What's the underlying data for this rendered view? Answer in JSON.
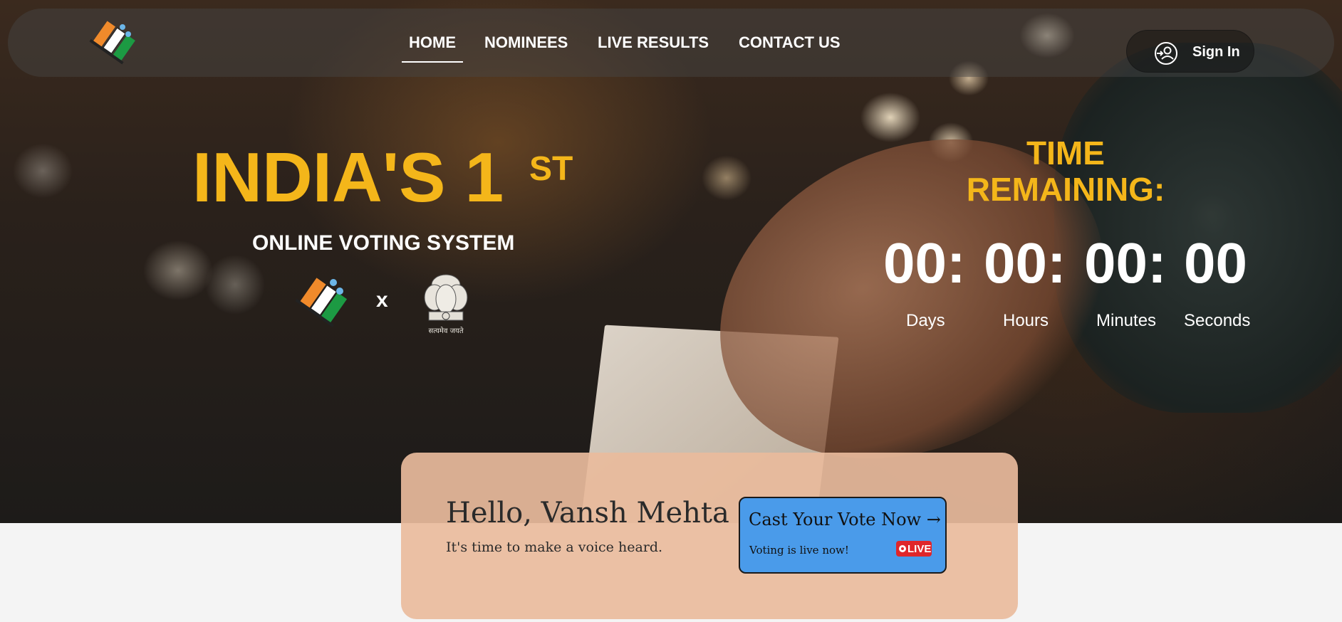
{
  "nav": {
    "items": [
      {
        "label": "HOME",
        "active": true
      },
      {
        "label": "NOMINEES",
        "active": false
      },
      {
        "label": "LIVE RESULTS",
        "active": false
      },
      {
        "label": "CONTACT US",
        "active": false
      }
    ],
    "signin_label": "Sign In"
  },
  "hero": {
    "title": "INDIA'S 1",
    "title_sup": "ST",
    "subtitle": "ONLINE VOTING SYSTEM",
    "separator": "x",
    "emblem_caption": "सत्यमेव जयते"
  },
  "countdown": {
    "title_line1": "TIME",
    "title_line2": "REMAINING:",
    "units": [
      {
        "value": "00:",
        "label": "Days"
      },
      {
        "value": "00:",
        "label": "Hours"
      },
      {
        "value": "00:",
        "label": "Minutes"
      },
      {
        "value": "00",
        "label": "Seconds"
      }
    ]
  },
  "greeting": {
    "title": "Hello, Vansh Mehta",
    "subtitle": "It's time to make a voice heard.",
    "cta_label": "Cast Your Vote Now →",
    "cta_status": "Voting is live now!",
    "live_badge": "LIVE"
  },
  "colors": {
    "accent_yellow": "#f4b61a",
    "card_bg": "#e9bb9c",
    "cta_bg": "#4a9bea",
    "live_red": "#e0262a"
  }
}
